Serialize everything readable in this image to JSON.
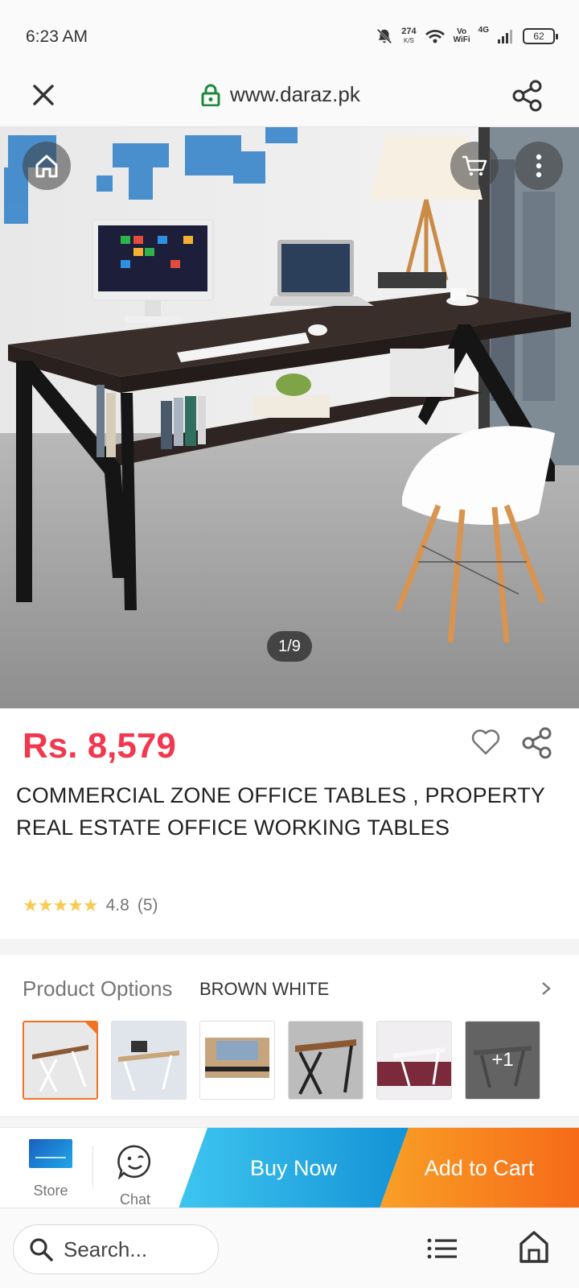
{
  "status_bar": {
    "time": "6:23 AM",
    "net_speed": "274",
    "net_unit": "K/S",
    "vowifi_line1": "Vo",
    "vowifi_line2": "WiFi",
    "network": "4G",
    "battery": "62"
  },
  "browser": {
    "url": "www.daraz.pk",
    "icons": [
      "close-icon",
      "lock-icon",
      "share-icon"
    ]
  },
  "gallery": {
    "counter": "1/9",
    "current": 1,
    "total": 9,
    "overlay_icons": [
      "home-icon",
      "cart-icon",
      "more-icon"
    ]
  },
  "product": {
    "price": "Rs. 8,579",
    "title": "COMMERCIAL ZONE OFFICE TABLES , PROPERTY REAL ESTATE OFFICE WORKING TABLES",
    "rating": 4.8,
    "rating_text": "4.8",
    "review_count": "(5)",
    "colors": {
      "price": "#f2384f",
      "star": "#faca51"
    }
  },
  "options": {
    "label": "Product Options",
    "value": "BROWN WHITE",
    "more_count": "+1",
    "thumbnails": [
      {
        "name": "thumb-1",
        "selected": true
      },
      {
        "name": "thumb-2",
        "selected": false
      },
      {
        "name": "thumb-3",
        "selected": false
      },
      {
        "name": "thumb-4",
        "selected": false
      },
      {
        "name": "thumb-5",
        "selected": false
      },
      {
        "name": "thumb-6",
        "selected": false
      }
    ]
  },
  "actions": {
    "store_label": "Store",
    "chat_label": "Chat",
    "buy_now": "Buy Now",
    "add_to_cart": "Add to Cart",
    "colors": {
      "buy_now": "#1ea5e0",
      "add_to_cart": "#f67a1f",
      "accent": "#f57224"
    }
  },
  "bottom_bar": {
    "search_placeholder": "Search..."
  }
}
